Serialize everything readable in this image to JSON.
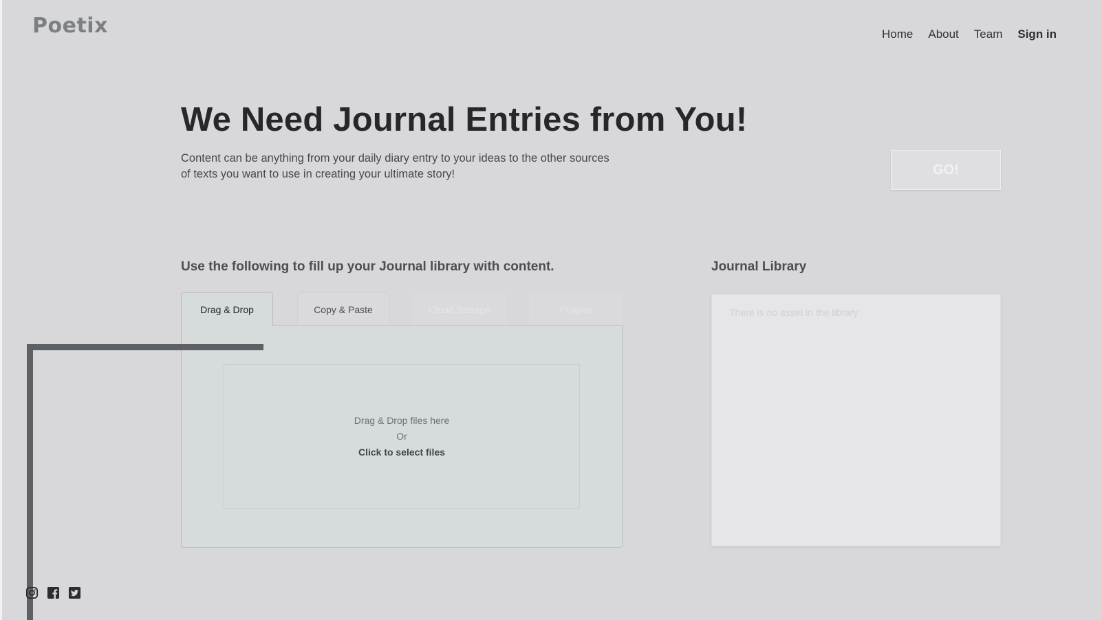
{
  "brand": {
    "name": "Poetix"
  },
  "nav": {
    "items": [
      "Home",
      "About",
      "Team"
    ],
    "signin": "Sign in"
  },
  "hero": {
    "title": "We Need Journal Entries from You!",
    "subtitle": "Content can be anything from your daily diary entry to your ideas to the other sources of texts you want to use in creating your ultimate story!",
    "go_label": "GO!"
  },
  "upload": {
    "heading": "Use the following to fill up your Journal library with content.",
    "tabs": [
      "Drag & Drop",
      "Copy & Paste",
      "Cloud Storage",
      "Plugins"
    ],
    "active_tab": "Drag & Drop",
    "dropzone": {
      "line1": "Drag & Drop files here",
      "line2": "Or",
      "click_label": "Click to select files"
    }
  },
  "library": {
    "heading": "Journal Library",
    "empty_text": "There is no asset in the library"
  },
  "social": {
    "icons": [
      "instagram-icon",
      "facebook-icon",
      "twitter-icon"
    ]
  },
  "colors": {
    "background": "#d8d8db",
    "panel": "#d6dbdc",
    "overlay": "#5d6064"
  }
}
